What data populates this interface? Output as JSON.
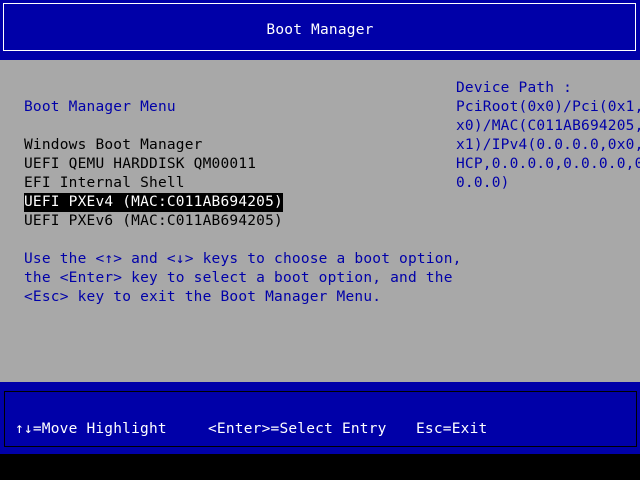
{
  "header": {
    "title": "Boot Manager"
  },
  "menu": {
    "title": "Boot Manager Menu",
    "items": [
      {
        "label": "Windows Boot Manager",
        "selected": false
      },
      {
        "label": "UEFI QEMU HARDDISK QM00011",
        "selected": false
      },
      {
        "label": "EFI Internal Shell",
        "selected": false
      },
      {
        "label": "UEFI PXEv4 (MAC:C011AB694205)",
        "selected": true
      },
      {
        "label": "UEFI PXEv6 (MAC:C011AB694205)",
        "selected": false
      }
    ]
  },
  "help": {
    "lines": [
      "Use the <↑> and <↓> keys to choose a boot option,",
      "the <Enter> key to select a boot option, and the",
      "<Esc> key to exit the Boot Manager Menu."
    ]
  },
  "device_path": {
    "label": "Device Path :",
    "lines": [
      "PciRoot(0x0)/Pci(0x1,0",
      "x0)/MAC(C011AB694205,0",
      "x1)/IPv4(0.0.0.0,0x0,D",
      "HCP,0.0.0.0,0.0.0.0,0.",
      "0.0.0)"
    ]
  },
  "footer": {
    "move": "↑↓=Move Highlight",
    "select": "<Enter>=Select Entry",
    "exit": "Esc=Exit"
  },
  "colors": {
    "header_bg": "#0000a8",
    "main_bg": "#a8a8a8",
    "text_blue": "#0000a8",
    "selected_bg": "#000000",
    "selected_fg": "#ffffff"
  }
}
